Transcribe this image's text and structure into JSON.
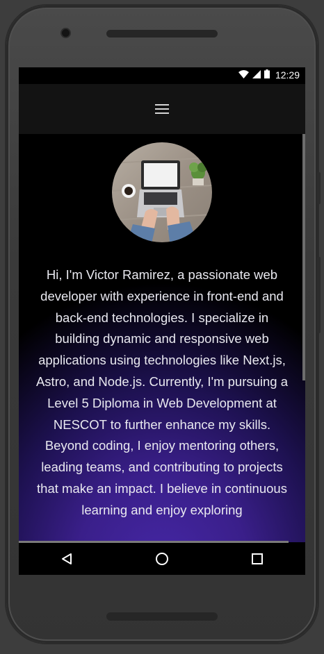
{
  "status_bar": {
    "time": "12:29",
    "icons": [
      "wifi-icon",
      "signal-icon",
      "battery-icon"
    ]
  },
  "header": {
    "menu_icon": "hamburger-menu-icon"
  },
  "profile": {
    "avatar_icon": "laptop-desk-photo"
  },
  "bio": {
    "paragraph_1": "Hi, I'm Victor Ramirez, a passionate web developer with experience in front-end and back-end technologies. I specialize in building dynamic and responsive web applications using technologies like Next.js, Astro, and Node.js. Currently, I'm pursuing a Level 5 Diploma in Web Development at NESCOT to further enhance my skills.",
    "paragraph_2": "Beyond coding, I enjoy mentoring others, leading teams, and contributing to projects that make an impact. I believe in continuous learning and enjoy exploring"
  },
  "nav": {
    "back_icon": "back-triangle-icon",
    "home_icon": "home-circle-icon",
    "recents_icon": "recents-square-icon"
  },
  "colors": {
    "accent_purple": "#4527a6",
    "header_bg": "#131313",
    "text": "#e9e9f0"
  }
}
